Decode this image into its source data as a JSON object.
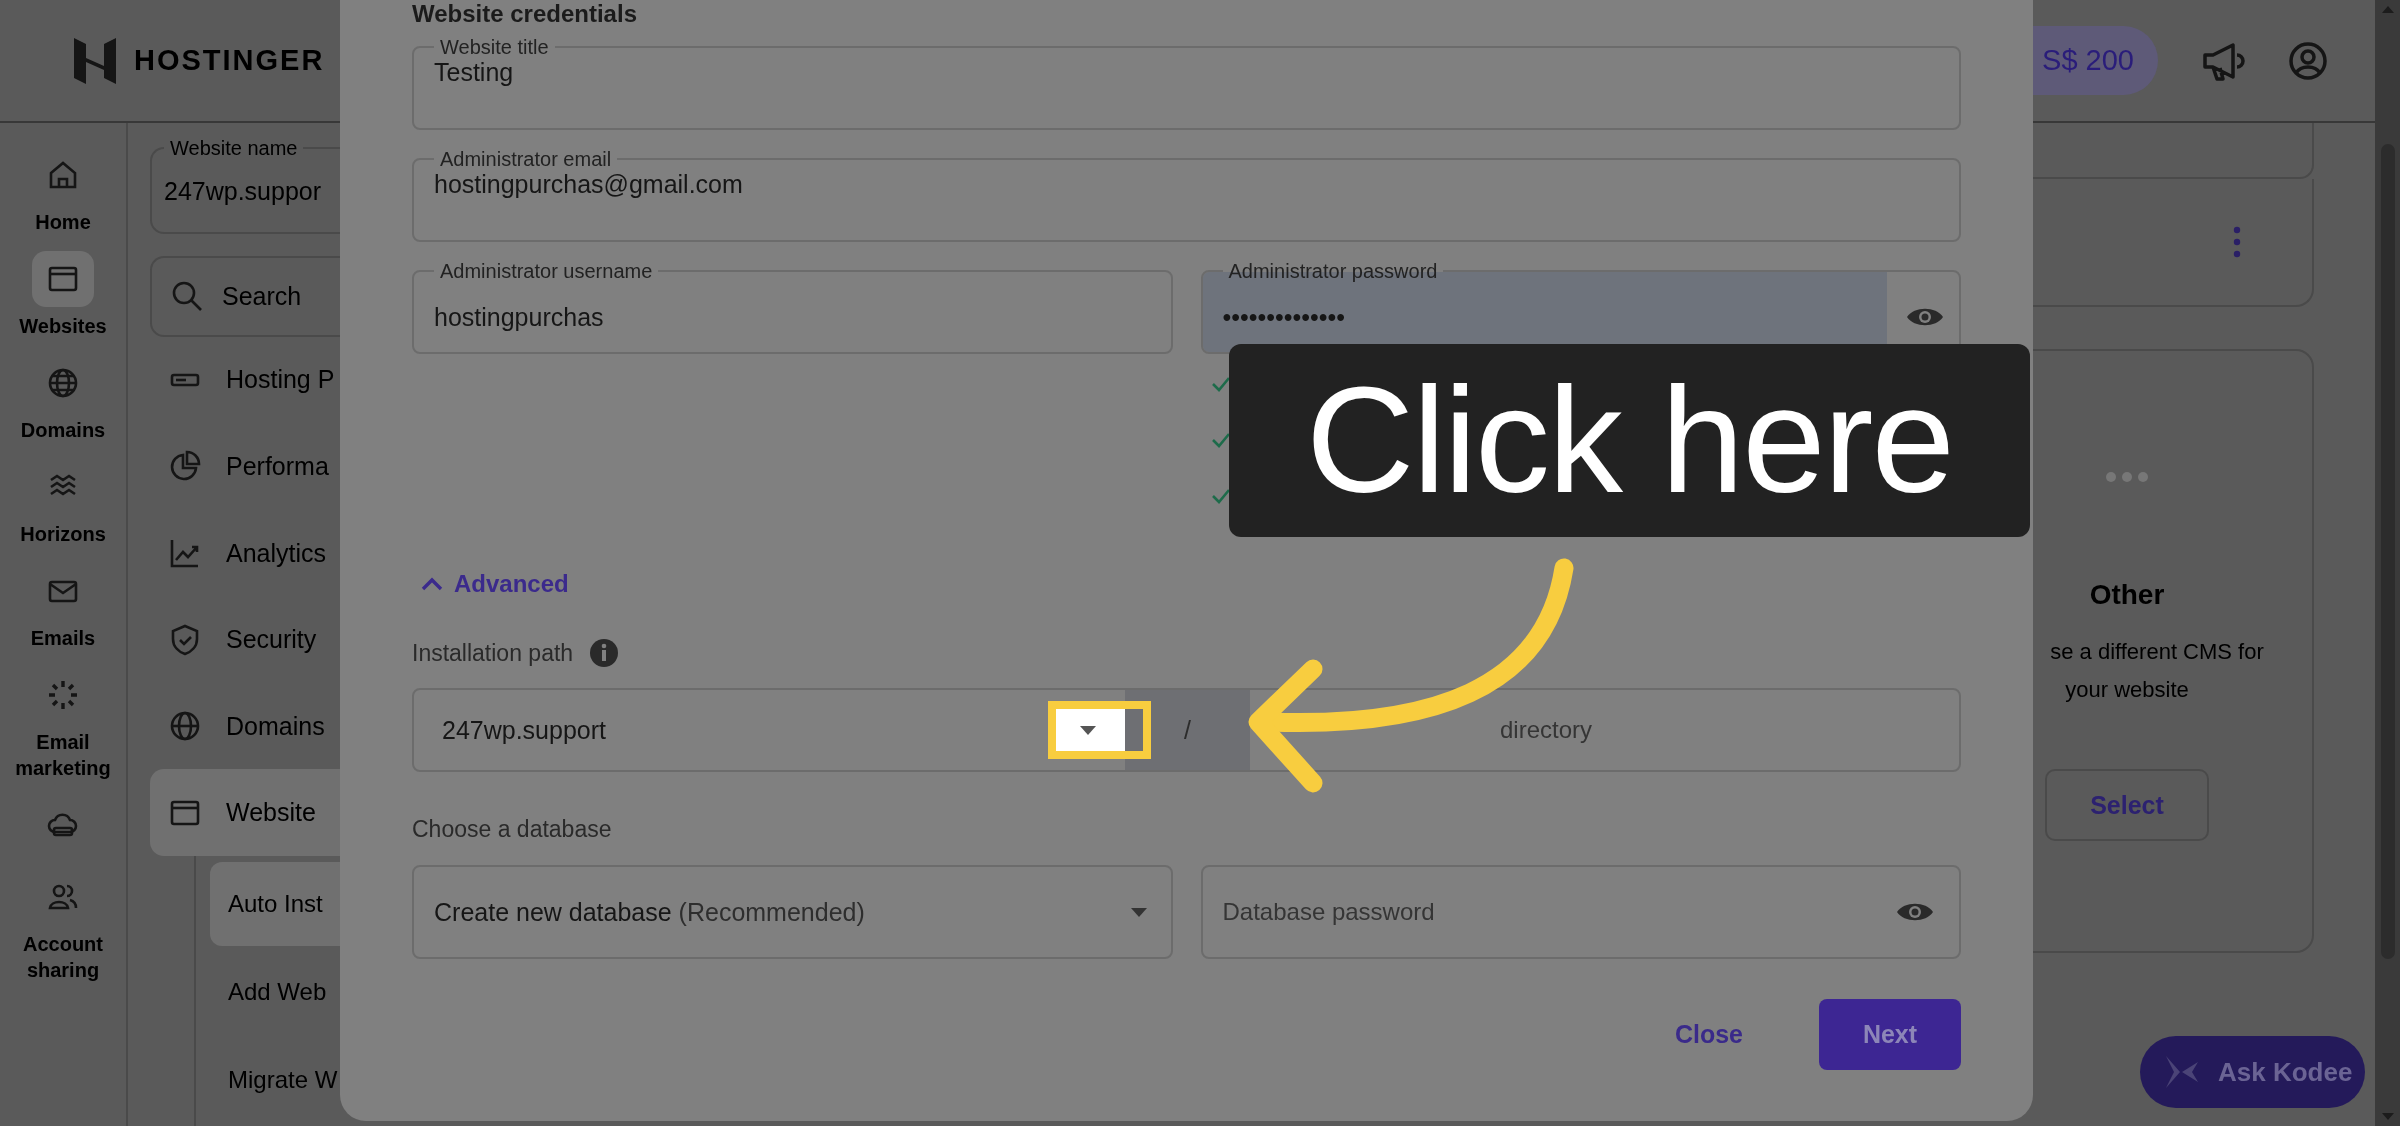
{
  "header": {
    "logo": "HOSTINGER",
    "balance": "S$ 200"
  },
  "rail": [
    {
      "label": "Home",
      "selected": false
    },
    {
      "label": "Websites",
      "selected": true
    },
    {
      "label": "Domains",
      "selected": false
    },
    {
      "label": "Horizons",
      "selected": false
    },
    {
      "label": "Emails",
      "selected": false
    },
    {
      "label": "Email marketing",
      "selected": false
    },
    {
      "selected": false
    },
    {
      "label": "Account sharing",
      "selected": false
    }
  ],
  "site_menu": {
    "website_name_label": "Website name",
    "website_name": "247wp.suppor",
    "search_placeholder": "Search",
    "items": [
      {
        "label": "Hosting P",
        "selected": false
      },
      {
        "label": "Performa",
        "selected": false
      },
      {
        "label": "Analytics",
        "selected": false
      },
      {
        "label": "Security",
        "selected": false
      },
      {
        "label": "Domains",
        "selected": false
      },
      {
        "label": "Website",
        "selected": true,
        "children": [
          {
            "label": "Auto Inst",
            "selected": true
          },
          {
            "label": "Add Web",
            "selected": false
          },
          {
            "label": "Migrate W",
            "selected": false
          }
        ]
      }
    ]
  },
  "modal": {
    "heading": "Website credentials",
    "title_field": {
      "label": "Website title",
      "value": "Testing"
    },
    "email_field": {
      "label": "Administrator email",
      "value": "hostingpurchas@gmail.com"
    },
    "username_field": {
      "label": "Administrator username",
      "value": "hostingpurchas"
    },
    "password_field": {
      "label": "Administrator password",
      "value": "••••••••••••••",
      "autofilled": true
    },
    "requirements": [
      {
        "met": true
      },
      {
        "met": true
      },
      {
        "met": true
      }
    ],
    "advanced": {
      "label": "Advanced",
      "expanded": true
    },
    "installation_path": {
      "label": "Installation path",
      "domain": "247wp.support",
      "separator": "/",
      "placeholder": "directory"
    },
    "database": {
      "label": "Choose a database",
      "value": "Create new database",
      "hint": "(Recommended)",
      "password_placeholder": "Database password"
    },
    "buttons": {
      "close": "Close",
      "next": "Next"
    }
  },
  "cms_cards": {
    "other": {
      "title": "Other",
      "description": [
        "se a different CMS for",
        "your website"
      ],
      "button": "Select"
    }
  },
  "callout": {
    "text": "Click here"
  },
  "assistant_button": "Ask Kodee"
}
